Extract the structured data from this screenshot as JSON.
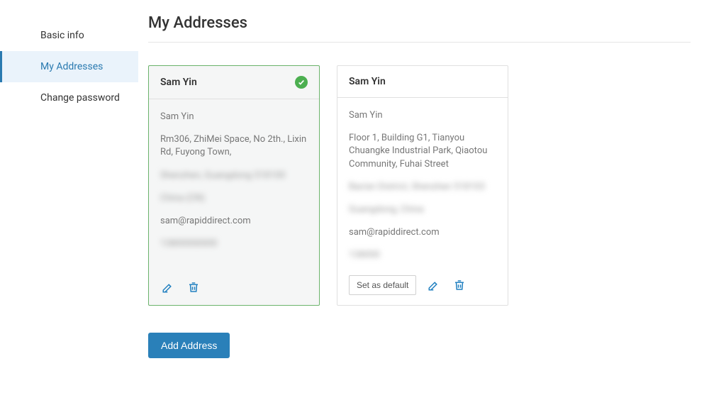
{
  "sidebar": {
    "items": [
      {
        "label": "Basic info"
      },
      {
        "label": "My Addresses"
      },
      {
        "label": "Change password"
      }
    ],
    "activeIndex": 1
  },
  "page": {
    "title": "My Addresses",
    "addButton": "Add Address",
    "setDefaultLabel": "Set as default"
  },
  "addresses": [
    {
      "title": "Sam Yin",
      "isDefault": true,
      "name": "Sam Yin",
      "street": "Rm306, ZhiMei Space, No 2th., Lixin Rd, Fuyong Town,",
      "hidden1": "Shenzhen, Guangdong 518100",
      "hidden2": "China (CN)",
      "email": "sam@rapiddirect.com",
      "hidden3": "13800000000"
    },
    {
      "title": "Sam Yin",
      "isDefault": false,
      "name": "Sam Yin",
      "street": "Floor 1, Building G1, Tianyou Chuangke Industrial Park, Qiaotou Community, Fuhai Street",
      "hidden1": "Bao'an District, Shenzhen 518103",
      "hidden2": "Guangdong, China",
      "email": "sam@rapiddirect.com",
      "hidden3": "138000"
    }
  ]
}
